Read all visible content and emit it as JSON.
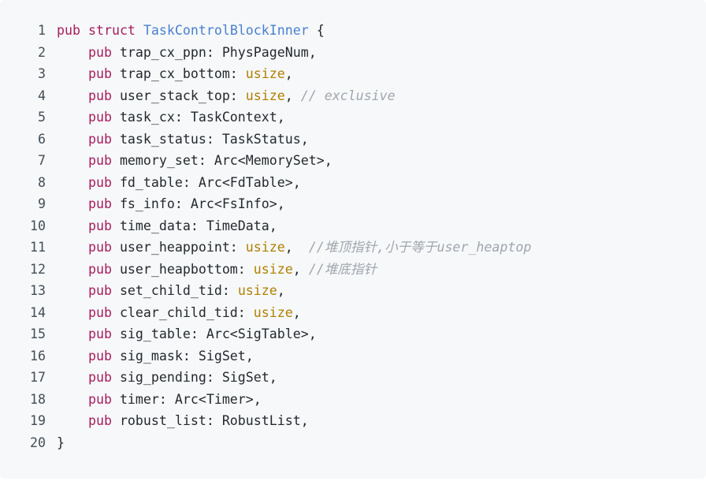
{
  "code_lines": [
    {
      "n": "1",
      "indent": "",
      "kw": "pub",
      "a": " ",
      "b": "struct",
      "c": " ",
      "type_name": "TaskControlBlockInner",
      "d": " {",
      "prim": "",
      "e": "",
      "comment": ""
    },
    {
      "n": "2",
      "indent": "    ",
      "kw": "pub",
      "a": " trap_cx_ppn: PhysPageNum,",
      "b": "",
      "c": "",
      "type_name": "",
      "d": "",
      "prim": "",
      "e": "",
      "comment": ""
    },
    {
      "n": "3",
      "indent": "    ",
      "kw": "pub",
      "a": " trap_cx_bottom: ",
      "b": "",
      "c": "",
      "type_name": "",
      "d": "",
      "prim": "usize",
      "e": ",",
      "comment": ""
    },
    {
      "n": "4",
      "indent": "    ",
      "kw": "pub",
      "a": " user_stack_top: ",
      "b": "",
      "c": "",
      "type_name": "",
      "d": "",
      "prim": "usize",
      "e": ", ",
      "comment": "// exclusive"
    },
    {
      "n": "5",
      "indent": "    ",
      "kw": "pub",
      "a": " task_cx: TaskContext,",
      "b": "",
      "c": "",
      "type_name": "",
      "d": "",
      "prim": "",
      "e": "",
      "comment": ""
    },
    {
      "n": "6",
      "indent": "    ",
      "kw": "pub",
      "a": " task_status: TaskStatus,",
      "b": "",
      "c": "",
      "type_name": "",
      "d": "",
      "prim": "",
      "e": "",
      "comment": ""
    },
    {
      "n": "7",
      "indent": "    ",
      "kw": "pub",
      "a": " memory_set: Arc<MemorySet>,",
      "b": "",
      "c": "",
      "type_name": "",
      "d": "",
      "prim": "",
      "e": "",
      "comment": ""
    },
    {
      "n": "8",
      "indent": "    ",
      "kw": "pub",
      "a": " fd_table: Arc<FdTable>,",
      "b": "",
      "c": "",
      "type_name": "",
      "d": "",
      "prim": "",
      "e": "",
      "comment": ""
    },
    {
      "n": "9",
      "indent": "    ",
      "kw": "pub",
      "a": " fs_info: Arc<FsInfo>,",
      "b": "",
      "c": "",
      "type_name": "",
      "d": "",
      "prim": "",
      "e": "",
      "comment": ""
    },
    {
      "n": "10",
      "indent": "    ",
      "kw": "pub",
      "a": " time_data: TimeData,",
      "b": "",
      "c": "",
      "type_name": "",
      "d": "",
      "prim": "",
      "e": "",
      "comment": ""
    },
    {
      "n": "11",
      "indent": "    ",
      "kw": "pub",
      "a": " user_heappoint: ",
      "b": "",
      "c": "",
      "type_name": "",
      "d": "",
      "prim": "usize",
      "e": ",  ",
      "comment": "//堆顶指针,小于等于user_heaptop"
    },
    {
      "n": "12",
      "indent": "    ",
      "kw": "pub",
      "a": " user_heapbottom: ",
      "b": "",
      "c": "",
      "type_name": "",
      "d": "",
      "prim": "usize",
      "e": ", ",
      "comment": "//堆底指针"
    },
    {
      "n": "13",
      "indent": "    ",
      "kw": "pub",
      "a": " set_child_tid: ",
      "b": "",
      "c": "",
      "type_name": "",
      "d": "",
      "prim": "usize",
      "e": ",",
      "comment": ""
    },
    {
      "n": "14",
      "indent": "    ",
      "kw": "pub",
      "a": " clear_child_tid: ",
      "b": "",
      "c": "",
      "type_name": "",
      "d": "",
      "prim": "usize",
      "e": ",",
      "comment": ""
    },
    {
      "n": "15",
      "indent": "    ",
      "kw": "pub",
      "a": " sig_table: Arc<SigTable>,",
      "b": "",
      "c": "",
      "type_name": "",
      "d": "",
      "prim": "",
      "e": "",
      "comment": ""
    },
    {
      "n": "16",
      "indent": "    ",
      "kw": "pub",
      "a": " sig_mask: SigSet,",
      "b": "",
      "c": "",
      "type_name": "",
      "d": "",
      "prim": "",
      "e": "",
      "comment": ""
    },
    {
      "n": "17",
      "indent": "    ",
      "kw": "pub",
      "a": " sig_pending: SigSet,",
      "b": "",
      "c": "",
      "type_name": "",
      "d": "",
      "prim": "",
      "e": "",
      "comment": ""
    },
    {
      "n": "18",
      "indent": "    ",
      "kw": "pub",
      "a": " timer: Arc<Timer>,",
      "b": "",
      "c": "",
      "type_name": "",
      "d": "",
      "prim": "",
      "e": "",
      "comment": ""
    },
    {
      "n": "19",
      "indent": "    ",
      "kw": "pub",
      "a": " robust_list: RobustList,",
      "b": "",
      "c": "",
      "type_name": "",
      "d": "",
      "prim": "",
      "e": "",
      "comment": ""
    },
    {
      "n": "20",
      "indent": "",
      "kw": "",
      "a": "}",
      "b": "",
      "c": "",
      "type_name": "",
      "d": "",
      "prim": "",
      "e": "",
      "comment": ""
    }
  ],
  "colors": {
    "background": "#f6f8fa",
    "keyword": "#a71d5d",
    "type_name": "#4a7fd0",
    "primitive_type": "#b07f00",
    "comment": "#a0a6ad",
    "text": "#24292e",
    "line_number": "#444d56"
  }
}
